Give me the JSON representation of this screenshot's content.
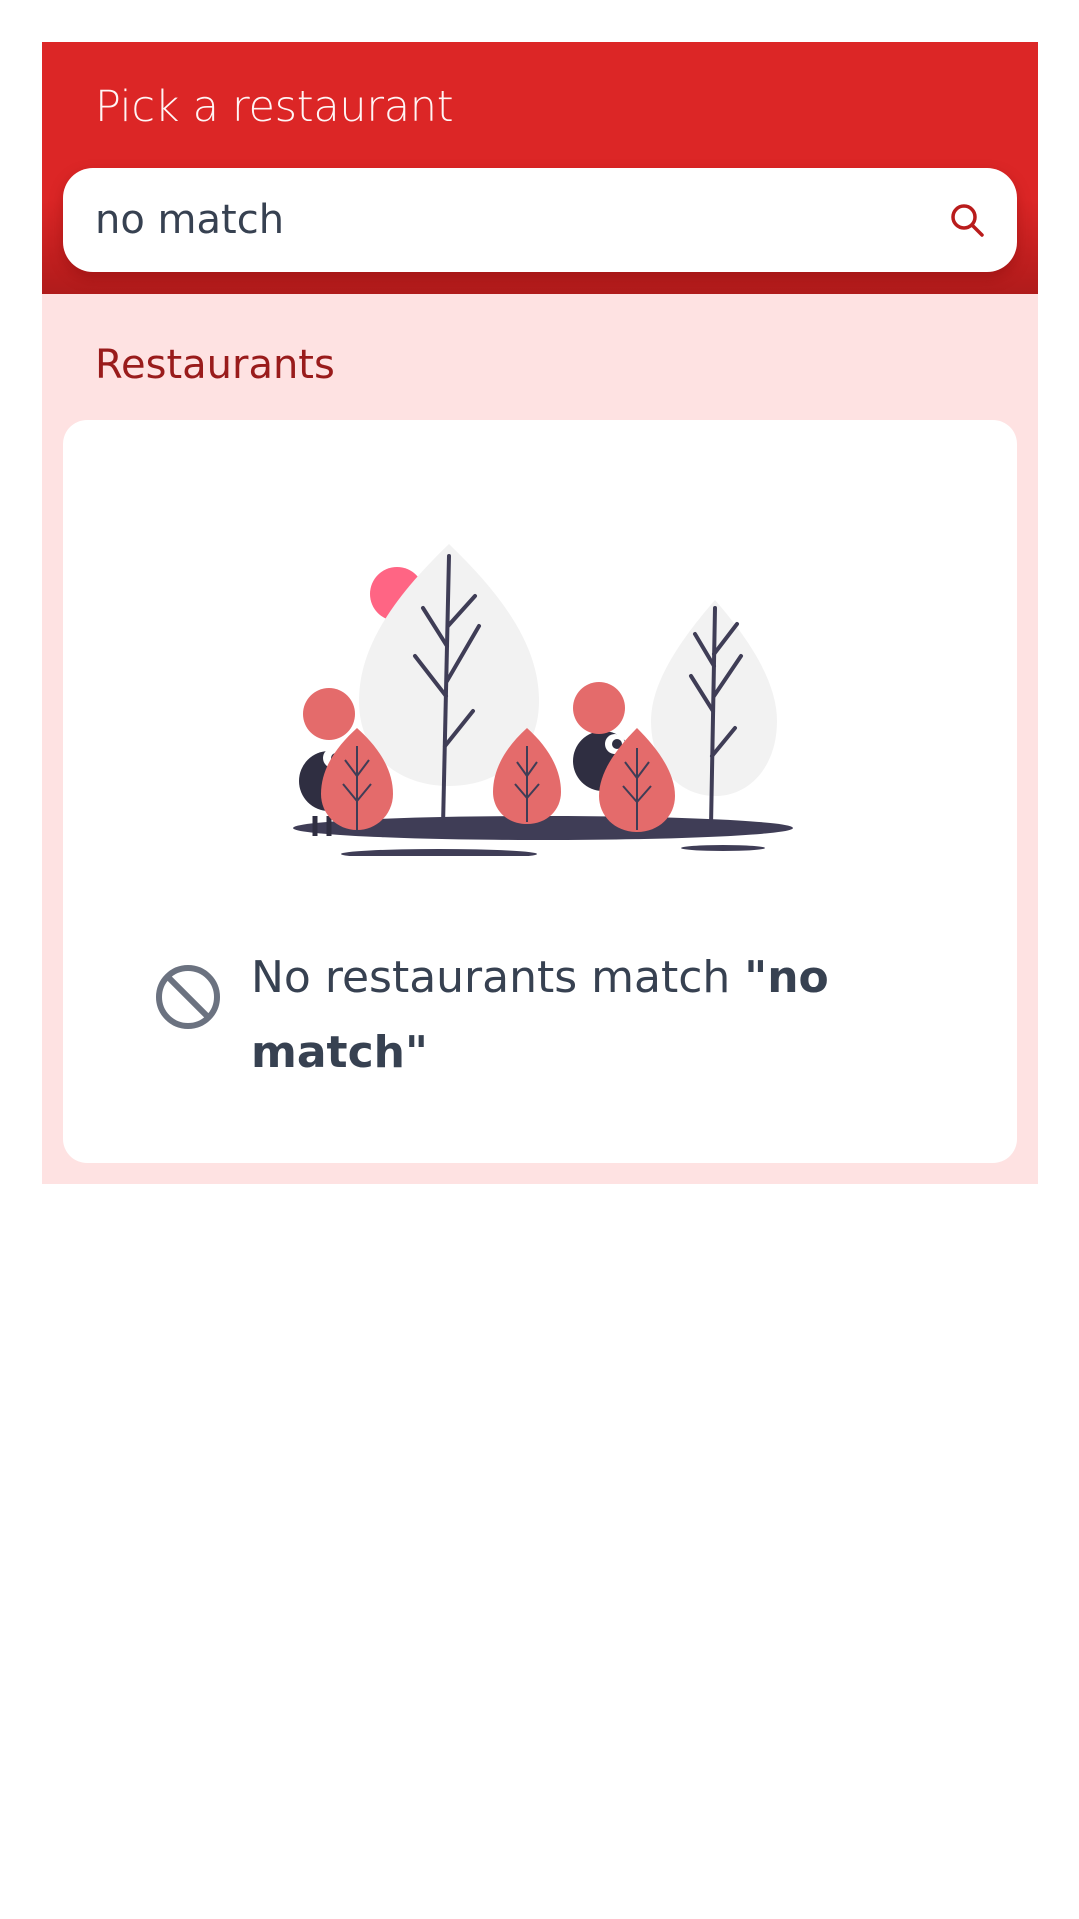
{
  "header": {
    "title": "Pick a restaurant"
  },
  "search": {
    "value": "no match",
    "icon": "search-icon"
  },
  "restaurants": {
    "section_title": "Restaurants",
    "empty_state": {
      "illustration": "trees-and-hiding-figures-illustration",
      "icon": "ban-icon",
      "message": "No restaurants match ",
      "query_display": "\"no match\""
    }
  },
  "colors": {
    "header_red": "#dc2626",
    "content_pink": "#fee2e2",
    "section_title": "#991b1b",
    "text": "#374151",
    "icon_gray": "#6b7280",
    "accent_coral": "#e46b6b"
  }
}
